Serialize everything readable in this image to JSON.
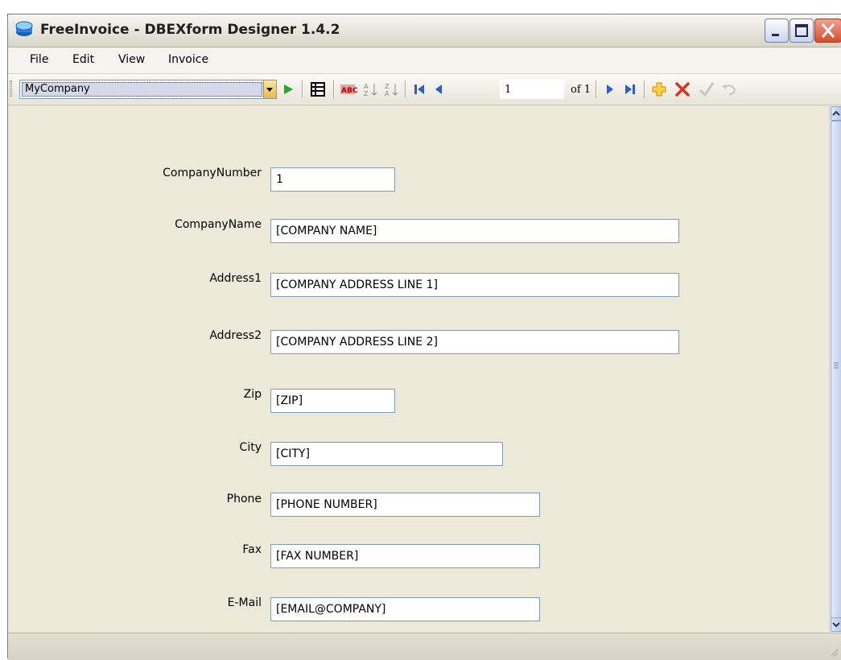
{
  "window": {
    "title": "FreeInvoice - DBEXform Designer 1.4.2"
  },
  "menu": {
    "items": [
      "File",
      "Edit",
      "View",
      "Invoice"
    ]
  },
  "toolbar": {
    "selected_table": "MyCompany",
    "position": "1",
    "record_count": "of 1"
  },
  "form": {
    "fields": [
      {
        "label": "CompanyNumber",
        "value": "1"
      },
      {
        "label": "CompanyName",
        "value": "[COMPANY NAME]"
      },
      {
        "label": "Address1",
        "value": "[COMPANY ADDRESS LINE 1]"
      },
      {
        "label": "Address2",
        "value": "[COMPANY ADDRESS LINE 2]"
      },
      {
        "label": "Zip",
        "value": "[ZIP]"
      },
      {
        "label": "City",
        "value": "[CITY]"
      },
      {
        "label": "Phone",
        "value": "[PHONE NUMBER]"
      },
      {
        "label": "Fax",
        "value": "[FAX NUMBER]"
      },
      {
        "label": "E-Mail",
        "value": "[EMAIL@COMPANY]"
      }
    ]
  }
}
